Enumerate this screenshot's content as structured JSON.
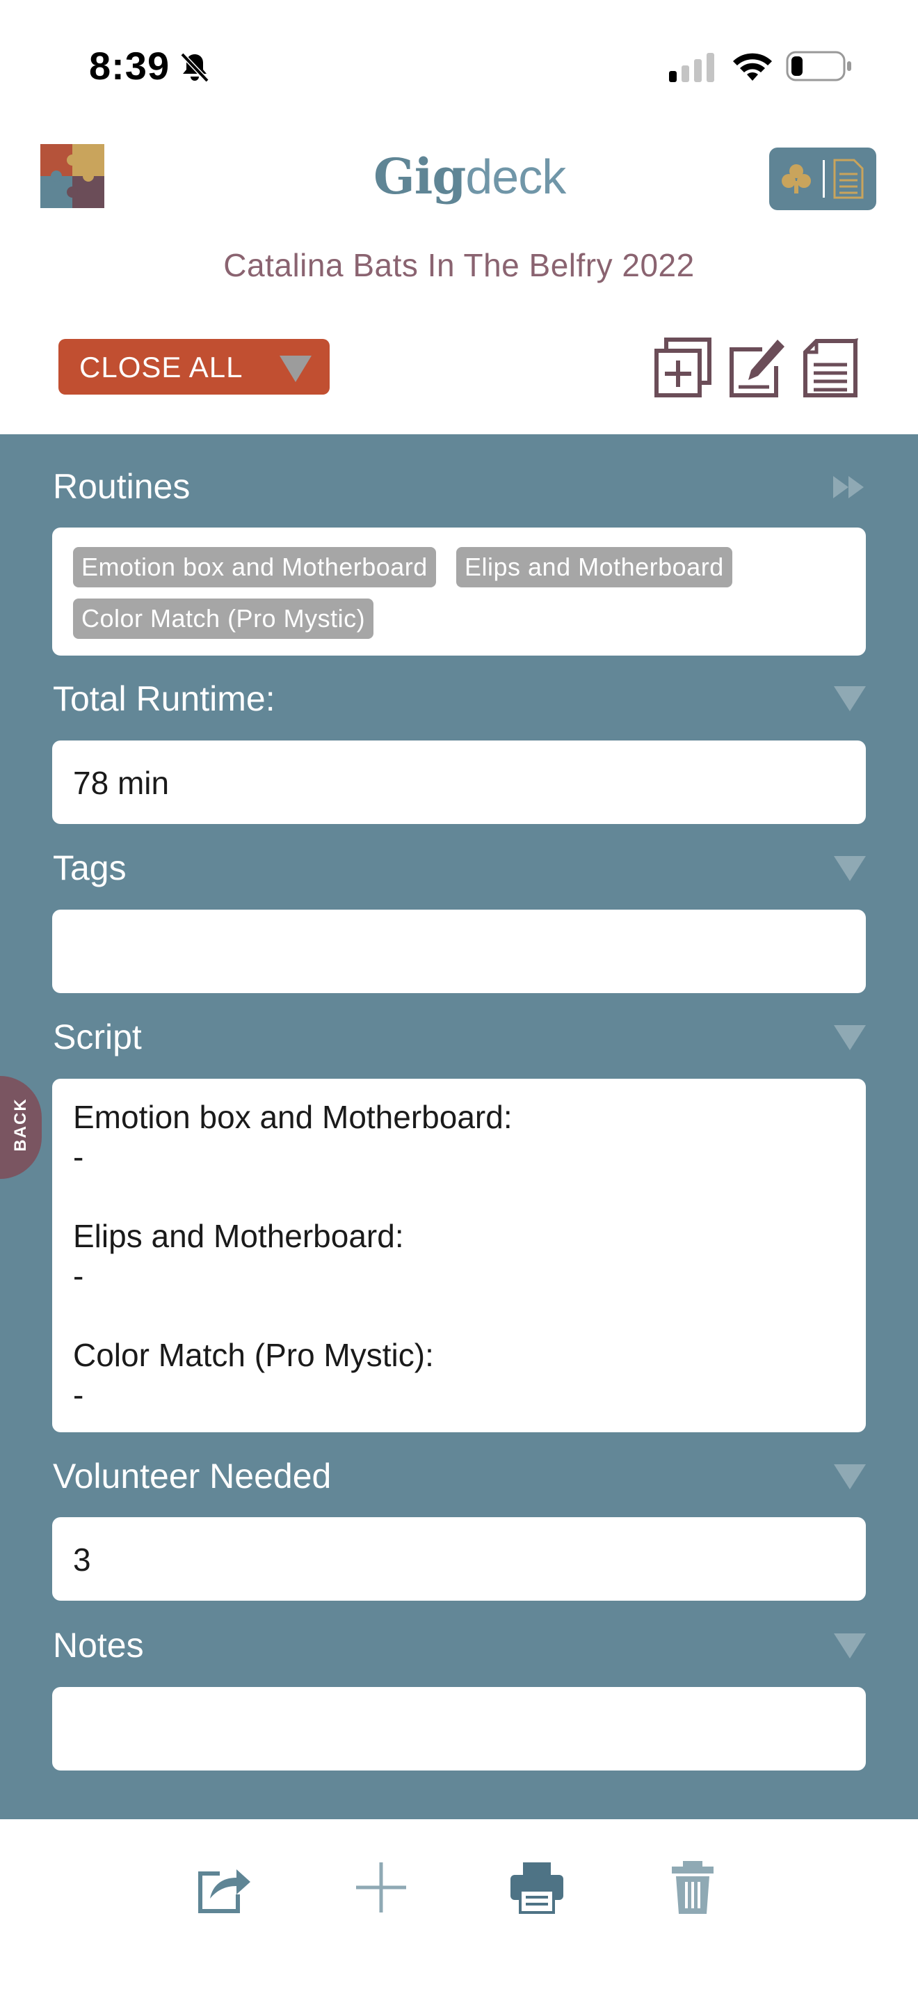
{
  "status_bar": {
    "time": "8:39",
    "icons": [
      "bell-slash-icon",
      "cellular-signal-icon",
      "wifi-icon",
      "battery-icon"
    ]
  },
  "header": {
    "brand_part1": "Gig",
    "brand_part2": "deck",
    "title": "Catalina Bats In The Belfry 2022",
    "close_all_label": "CLOSE ALL",
    "toolbar_icons": [
      "add-duplicate-icon",
      "edit-icon",
      "notes-icon"
    ]
  },
  "fields": {
    "routines": {
      "label": "Routines",
      "chips": [
        "Emotion box and Motherboard",
        "Elips and Motherboard",
        "Color Match (Pro Mystic)"
      ]
    },
    "total_runtime": {
      "label": "Total Runtime:",
      "value": "78 min"
    },
    "tags": {
      "label": "Tags",
      "value": ""
    },
    "script": {
      "label": "Script",
      "lines": [
        "Emotion box and Motherboard:",
        "-",
        "Elips and Motherboard:",
        "-",
        "Color Match (Pro Mystic):",
        "-"
      ]
    },
    "volunteer_needed": {
      "label": "Volunteer Needed",
      "value": "3"
    },
    "notes": {
      "label": "Notes",
      "value": ""
    }
  },
  "back_tab": {
    "label": "BACK"
  },
  "bottom_toolbar": {
    "icons": [
      "share-icon",
      "add-icon",
      "print-icon",
      "trash-icon"
    ]
  },
  "colors": {
    "panel_bg": "#638797",
    "accent_orange": "#c14f31",
    "title_mauve": "#8a6370",
    "brand_blue": "#5f8595",
    "chip_gray": "#a6a6a6",
    "icon_plum": "#6b4d58"
  }
}
